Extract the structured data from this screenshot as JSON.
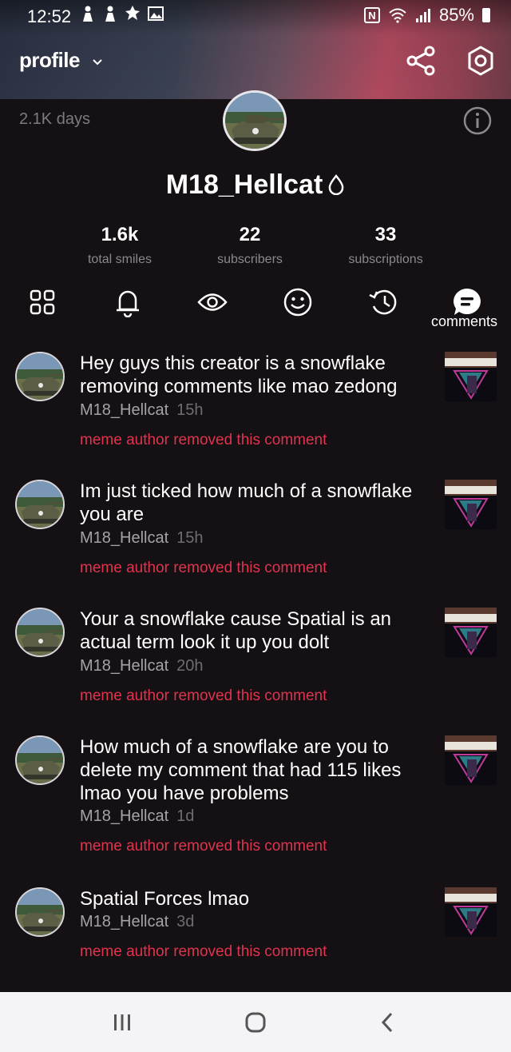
{
  "status_bar": {
    "time": "12:52",
    "battery": "85%",
    "left_icons": [
      "person-icon",
      "person-icon",
      "leaf-icon",
      "image-icon"
    ],
    "right_icons": [
      "nfc-icon",
      "wifi-icon",
      "signal-icon",
      "battery-icon"
    ]
  },
  "header": {
    "title": "profile",
    "icons": [
      "chevron-down-icon",
      "share-icon",
      "settings-icon"
    ]
  },
  "profile": {
    "days": "2.1K days",
    "username": "M18_Hellcat",
    "badge_icon": "drop-icon",
    "stats": [
      {
        "value": "1.6k",
        "label": "total smiles"
      },
      {
        "value": "22",
        "label": "subscribers"
      },
      {
        "value": "33",
        "label": "subscriptions"
      }
    ]
  },
  "tabs": {
    "items": [
      "grid-icon",
      "bell-icon",
      "eye-icon",
      "smile-icon",
      "history-icon",
      "comments-icon"
    ],
    "active_label": "comments"
  },
  "comments": [
    {
      "text": "Hey guys this creator is a snowflake removing comments like mao zedong",
      "author": "M18_Hellcat",
      "time": "15h",
      "removed": "meme author removed this comment"
    },
    {
      "text": "Im just ticked how much of a snowflake you are",
      "author": "M18_Hellcat",
      "time": "15h",
      "removed": "meme author removed this comment"
    },
    {
      "text": "Your a snowflake cause Spatial is an actual term look it up you dolt",
      "author": "M18_Hellcat",
      "time": "20h",
      "removed": "meme author removed this comment"
    },
    {
      "text": "How much of a snowflake are you to delete my comment that had 115 likes lmao you have problems",
      "author": "M18_Hellcat",
      "time": "1d",
      "removed": "meme author removed this comment"
    },
    {
      "text": "Spatial Forces lmao",
      "author": "M18_Hellcat",
      "time": "3d",
      "removed": "meme author removed this comment"
    }
  ],
  "colors": {
    "background": "#141013",
    "removed_text": "#e0344e",
    "muted_text": "#8b888e"
  }
}
